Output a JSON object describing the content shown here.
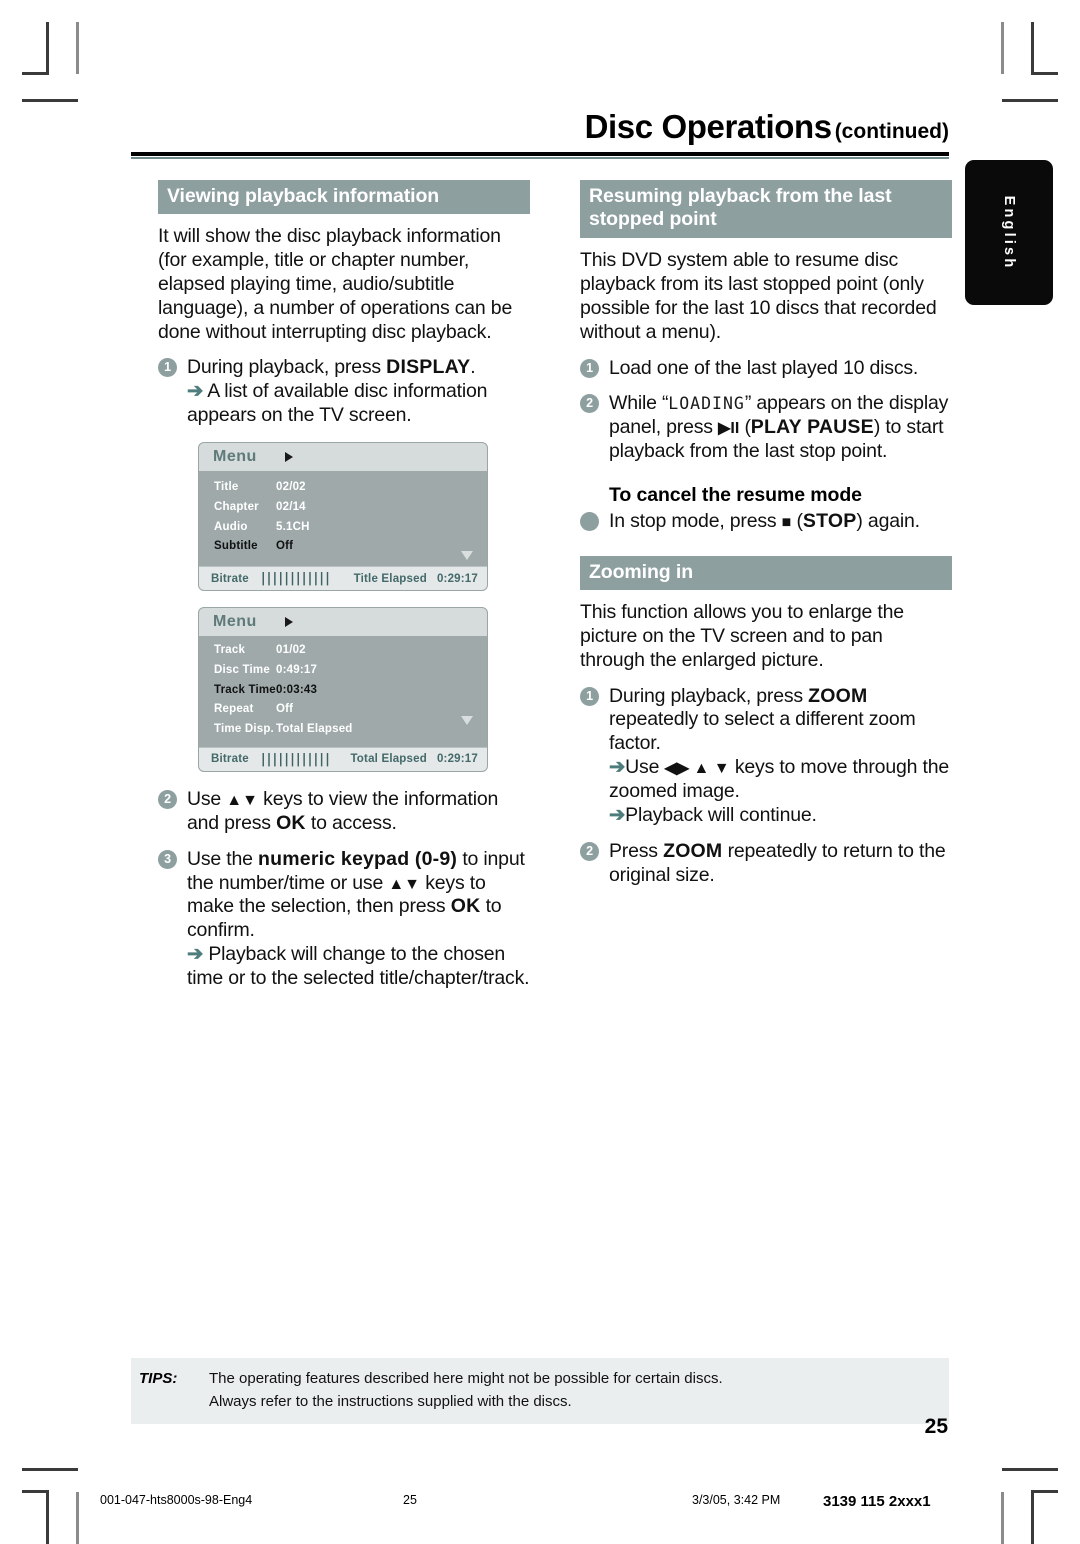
{
  "header": {
    "title_main": "Disc Operations",
    "title_continued": "(continued)"
  },
  "language_tab": {
    "label": "English"
  },
  "left_column": {
    "section": {
      "heading": "Viewing playback information"
    },
    "intro": "It will show the disc playback information (for example, title or chapter number, elapsed playing time, audio/subtitle language), a number of operations can be done without interrupting disc playback.",
    "steps": [
      {
        "num": "1",
        "text_a": "During playback, press ",
        "bold": "DISPLAY",
        "text_b": ".",
        "result": "A list of available disc information appears on the TV screen."
      },
      {
        "num": "2",
        "text_a": "Use ",
        "keys": "▲▼",
        "text_b": " keys to view the information and press ",
        "bold": "OK",
        "text_c": " to access."
      },
      {
        "num": "3",
        "text_a": "Use the ",
        "bold": "numeric keypad (0-9)",
        "text_b": " to input the number/time or use ",
        "keys": "▲▼",
        "text_c": " keys to make the selection, then press ",
        "bold2": "OK",
        "text_d": " to confirm.",
        "result": "Playback will change to the chosen time or to the selected title/chapter/track."
      }
    ]
  },
  "osd_panels": [
    {
      "title": "Menu",
      "rows": [
        {
          "key": "Title",
          "value": "02/02",
          "selected": false
        },
        {
          "key": "Chapter",
          "value": "02/14",
          "selected": false
        },
        {
          "key": "Audio",
          "value": "5.1CH",
          "selected": false
        },
        {
          "key": "Subtitle",
          "value": "Off",
          "selected": true
        }
      ],
      "footer": {
        "bitrate_label": "Bitrate",
        "bitrate_bars": "||||||||||||",
        "time_label": "Title Elapsed",
        "time_value": "0:29:17"
      }
    },
    {
      "title": "Menu",
      "rows": [
        {
          "key": "Track",
          "value": "01/02",
          "selected": false
        },
        {
          "key": "Disc Time",
          "value": "0:49:17",
          "selected": false
        },
        {
          "key": "Track Time",
          "value": "0:03:43",
          "selected": true
        },
        {
          "key": "Repeat",
          "value": "Off",
          "selected": false
        },
        {
          "key": "Time Disp.",
          "value": "Total Elapsed",
          "selected": false
        }
      ],
      "footer": {
        "bitrate_label": "Bitrate",
        "bitrate_bars": "||||||||||||",
        "time_label": "Total Elapsed",
        "time_value": "0:29:17"
      }
    }
  ],
  "right_column": {
    "resume": {
      "heading": "Resuming playback from the last stopped point",
      "intro": "This DVD system able to resume disc playback from its last stopped point (only possible for the last 10 discs that recorded without a menu).",
      "steps": [
        {
          "num": "1",
          "text_a": "Load one of the last played 10 discs."
        },
        {
          "num": "2",
          "text_a": "While “",
          "lcd": "LOADING",
          "text_b": "” appears on the display panel, press ",
          "glyph": "▶II",
          "text_c": " (",
          "bold": "PLAY PAUSE",
          "text_d": ") to start playback from the last stop point."
        }
      ],
      "cancel_subhead": "To cancel the resume mode",
      "cancel_step": {
        "text_a": "In stop mode, press  ",
        "glyph": "■",
        "text_b": " (",
        "bold": "STOP",
        "text_c": ") again."
      }
    },
    "zoom": {
      "heading": "Zooming in",
      "intro": "This function allows you to enlarge the picture on the TV screen and to pan through the enlarged picture.",
      "steps": [
        {
          "num": "1",
          "text_a": "During playback, press ",
          "bold": "ZOOM",
          "text_b": " repeatedly to select a different zoom factor.",
          "result_a": "Use ",
          "result_keys": "◀▶ ▲ ▼",
          "result_b": " keys to move through the zoomed image.",
          "result2": "Playback will continue."
        },
        {
          "num": "2",
          "text_a": "Press ",
          "bold": "ZOOM",
          "text_b": " repeatedly to return to the original size."
        }
      ]
    }
  },
  "tips": {
    "label": "TIPS:",
    "line1": "The operating features described here might not be possible for certain discs.",
    "line2": "Always refer to the instructions supplied with the discs."
  },
  "page_number": "25",
  "printer_footer": {
    "file": "001-047-hts8000s-98-Eng4",
    "page": "25",
    "date": "3/3/05, 3:42 PM",
    "code": "3139 115 2xxx1"
  },
  "colors": {
    "accent_bar": "#8e9fa0",
    "osd_body": "#9fa9a9",
    "osd_title": "#d6dbdb",
    "tips_bg": "#ebeeee",
    "rule_teal": "#6f8a8a"
  }
}
